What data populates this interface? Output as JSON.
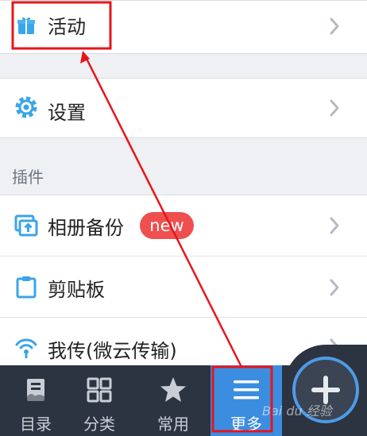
{
  "menu": {
    "activity": {
      "label": "活动",
      "icon": "gift-icon"
    },
    "settings": {
      "label": "设置",
      "icon": "gear-icon"
    }
  },
  "plugins": {
    "title": "插件",
    "items": [
      {
        "label": "相册备份",
        "badge": "new",
        "icon": "photo-backup-icon"
      },
      {
        "label": "剪贴板",
        "icon": "clipboard-icon"
      },
      {
        "label": "我传(微云传输)",
        "icon": "wifi-transfer-icon"
      }
    ]
  },
  "tabbar": {
    "tabs": [
      {
        "label": "目录",
        "icon": "directory-icon"
      },
      {
        "label": "分类",
        "icon": "grid-icon"
      },
      {
        "label": "常用",
        "icon": "star-icon"
      },
      {
        "label": "更多",
        "icon": "menu-icon",
        "active": true
      }
    ],
    "fab_icon": "plus-icon"
  },
  "watermark": "Bai du 经验",
  "colors": {
    "accent": "#3b8de0",
    "tabbar_bg": "#2b3440",
    "badge": "#ef4f4f",
    "annotation": "#e8141b"
  }
}
